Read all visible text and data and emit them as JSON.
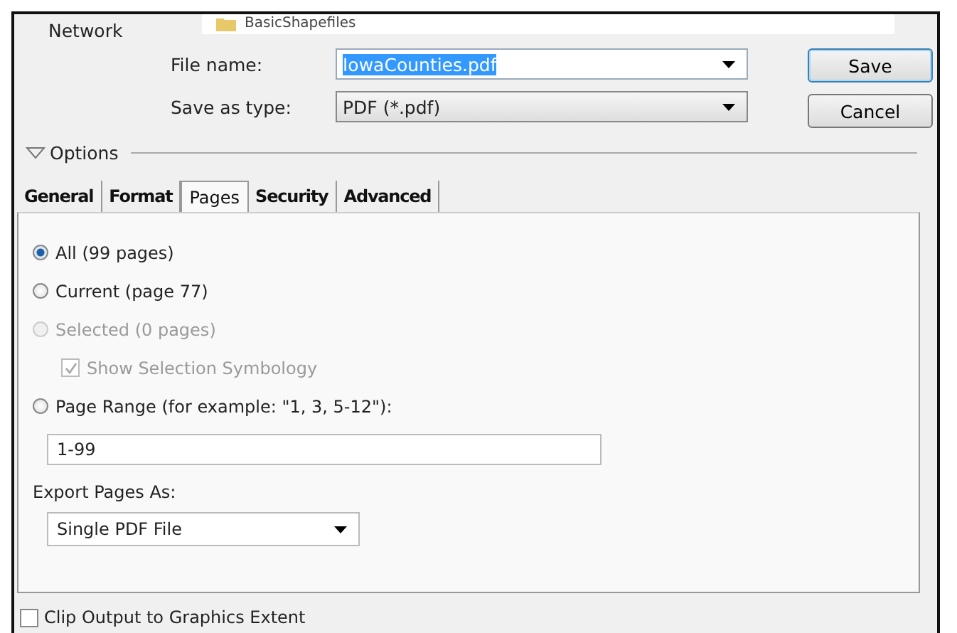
{
  "file_list": {
    "item": "BasicShapefiles"
  },
  "nav": {
    "item": "Network"
  },
  "fields": [
    {
      "kind": "combo",
      "label": "File name:",
      "value": "IowaCounties.pdf",
      "highlighted": true
    },
    {
      "kind": "select",
      "label": "Save as type:",
      "value": "PDF (*.pdf)",
      "highlighted": false
    }
  ],
  "buttons": [
    {
      "label": "Save",
      "default": true
    },
    {
      "label": "Cancel",
      "default": false
    }
  ],
  "options": {
    "label": "Options",
    "expanded": true
  },
  "tabs": [
    {
      "label": "General",
      "selected": false
    },
    {
      "label": "Format",
      "selected": false
    },
    {
      "label": "Pages",
      "selected": true
    },
    {
      "label": "Security",
      "selected": false
    },
    {
      "label": "Advanced",
      "selected": false
    }
  ],
  "pages": [
    {
      "kind": "radio",
      "label": "All (99 pages)",
      "selected": true,
      "disabled": false
    },
    {
      "kind": "radio",
      "label": "Current (page 77)",
      "selected": false,
      "disabled": false
    },
    {
      "kind": "radio",
      "label": "Selected (0 pages)",
      "selected": false,
      "disabled": true
    },
    {
      "kind": "checkbox",
      "label": "Show Selection Symbology",
      "checked": true,
      "disabled": true
    },
    {
      "kind": "radio",
      "label": "Page Range (for example: \"1, 3, 5-12\"):",
      "selected": false,
      "disabled": false
    }
  ],
  "page_range": {
    "value": "1-99"
  },
  "export": {
    "label": "Export Pages As:",
    "value": "Single PDF File"
  },
  "clip_output": {
    "label": "Clip Output to Graphics Extent",
    "checked": false
  }
}
